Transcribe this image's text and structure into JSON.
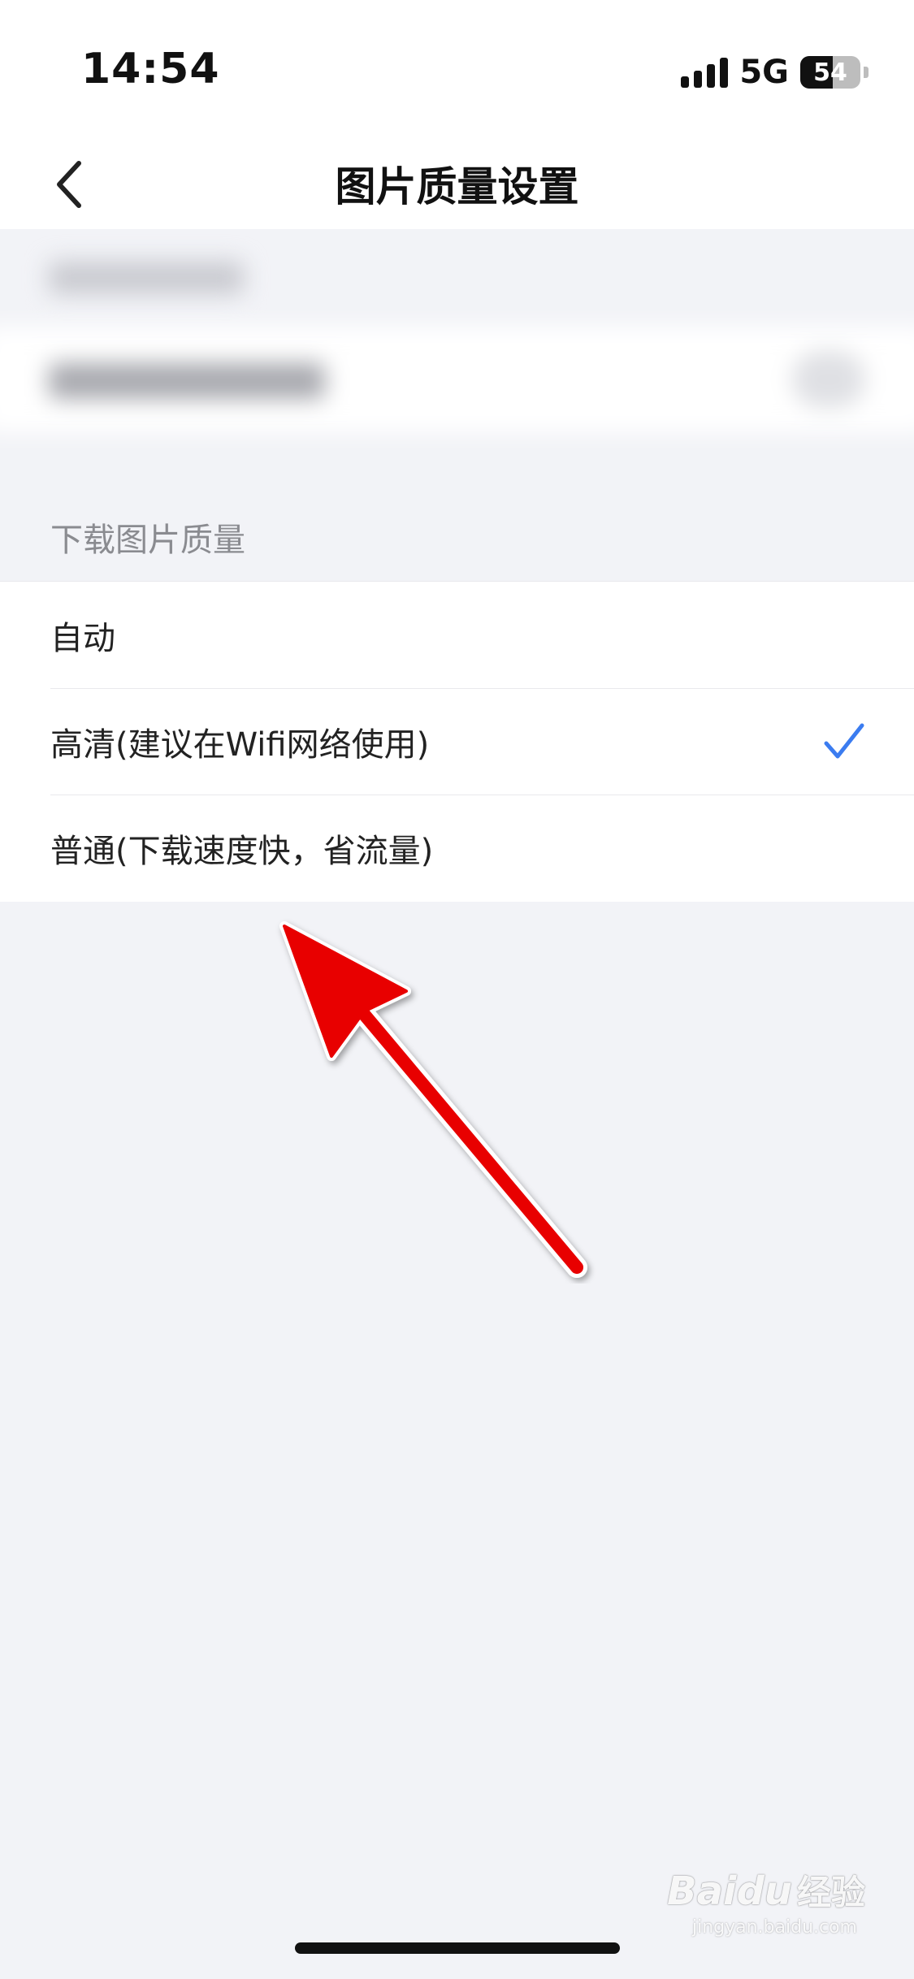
{
  "status_bar": {
    "time": "14:54",
    "network": "5G",
    "battery": "54",
    "battery_level": 0.54
  },
  "nav": {
    "title": "图片质量设置",
    "back_icon": "chevron-left-icon"
  },
  "section": {
    "header": "下载图片质量"
  },
  "options": [
    {
      "label": "自动",
      "selected": false
    },
    {
      "label": "高清(建议在Wifi网络使用)",
      "selected": true
    },
    {
      "label": "普通(下载速度快，省流量)",
      "selected": false
    }
  ],
  "colors": {
    "accent": "#3b7cf0",
    "arrow": "#e80000",
    "background": "#f2f3f7"
  },
  "watermark": {
    "brand": "Baidu",
    "sub": "经验",
    "domain": "jingyan.baidu.com"
  }
}
